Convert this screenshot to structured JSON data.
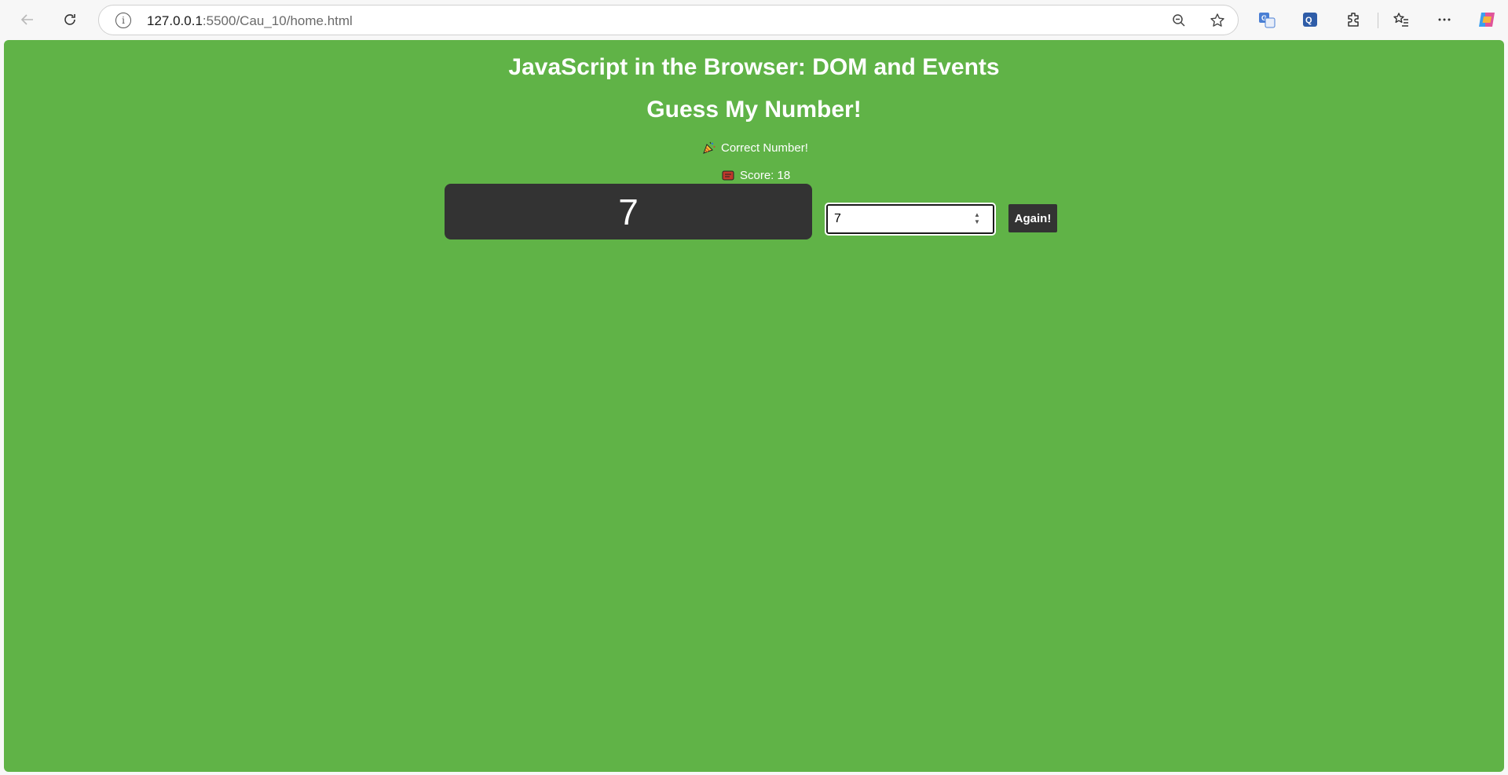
{
  "browser": {
    "url_host": "127.0.0.1",
    "url_path": ":5500/Cau_10/home.html"
  },
  "page": {
    "title": "JavaScript in the Browser: DOM and Events",
    "subtitle": "Guess My Number!",
    "message": "Correct Number!",
    "score_text": "Score: 18",
    "secret_number": "7",
    "guess_value": "7",
    "again_label": "Again!",
    "background_color": "#60b347",
    "box_color": "#333333",
    "icons": {
      "message": "party-popper-icon",
      "score": "score-icon"
    }
  }
}
